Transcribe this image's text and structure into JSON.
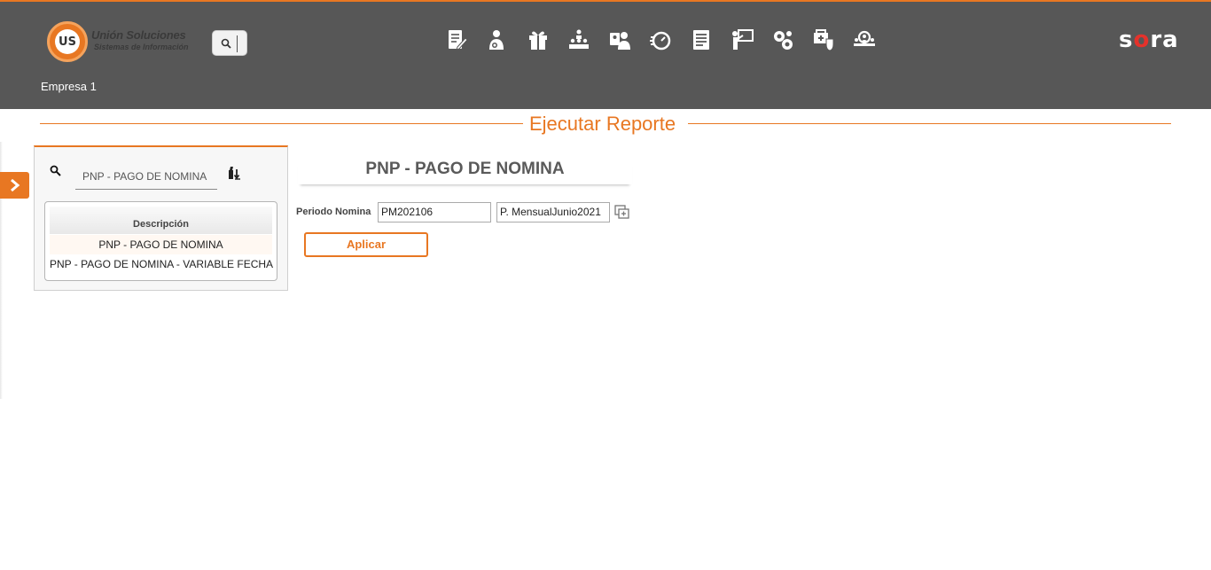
{
  "header": {
    "logo": {
      "title": "Unión Soluciones",
      "subtitle": "Sistemas de Información",
      "badge": "US"
    },
    "brand": {
      "before": "s",
      "accent": "o",
      "after": "ra"
    },
    "company": "Empresa 1",
    "nav_icons": [
      "document-edit-icon",
      "person-settings-icon",
      "gift-icon",
      "org-chart-icon",
      "id-badge-icon",
      "timer-icon",
      "report-list-icon",
      "presentation-icon",
      "gears-icon",
      "truck-shield-icon",
      "users-search-icon"
    ],
    "accent_color": "#e87722",
    "bar_color": "#575757"
  },
  "page": {
    "title": "Ejecutar Reporte"
  },
  "search_panel": {
    "query": "PNP - PAGO DE NOMINA",
    "table": {
      "header": "Descripción",
      "rows": [
        "PNP - PAGO DE NOMINA",
        "PNP - PAGO DE NOMINA - VARIABLE FECHA"
      ]
    }
  },
  "report": {
    "name": "PNP - PAGO DE NOMINA",
    "param_label": "Periodo Nomina",
    "param_code": "PM202106",
    "param_desc": "P. MensualJunio2021",
    "apply_label": "Aplicar"
  }
}
